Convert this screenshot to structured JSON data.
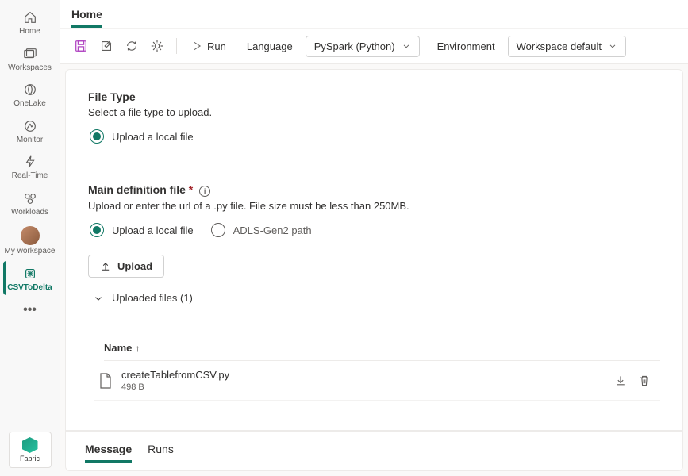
{
  "sidebar": {
    "items": [
      {
        "label": "Home",
        "icon": "home"
      },
      {
        "label": "Workspaces",
        "icon": "workspaces"
      },
      {
        "label": "OneLake",
        "icon": "onelake"
      },
      {
        "label": "Monitor",
        "icon": "monitor"
      },
      {
        "label": "Real-Time",
        "icon": "realtime"
      },
      {
        "label": "Workloads",
        "icon": "workloads"
      },
      {
        "label": "My workspace",
        "icon": "avatar"
      },
      {
        "label": "CSVToDelta",
        "icon": "spark",
        "selected": true
      }
    ],
    "fabric_label": "Fabric"
  },
  "header": {
    "breadcrumb": "Home"
  },
  "toolbar": {
    "run_label": "Run",
    "language_label": "Language",
    "language_value": "PySpark (Python)",
    "environment_label": "Environment",
    "environment_value": "Workspace default"
  },
  "form": {
    "file_type_title": "File Type",
    "file_type_desc": "Select a file type to upload.",
    "file_type_option": "Upload a local file",
    "main_def_title": "Main definition file",
    "main_def_desc": "Upload or enter the url of a .py file. File size must be less than 250MB.",
    "main_def_radio_local": "Upload a local file",
    "main_def_radio_adls": "ADLS-Gen2 path",
    "upload_button": "Upload",
    "uploaded_files_label": "Uploaded files (1)"
  },
  "table": {
    "name_header": "Name",
    "rows": [
      {
        "name": "createTablefromCSV.py",
        "size": "498 B"
      }
    ]
  },
  "tabs": {
    "message": "Message",
    "runs": "Runs"
  }
}
